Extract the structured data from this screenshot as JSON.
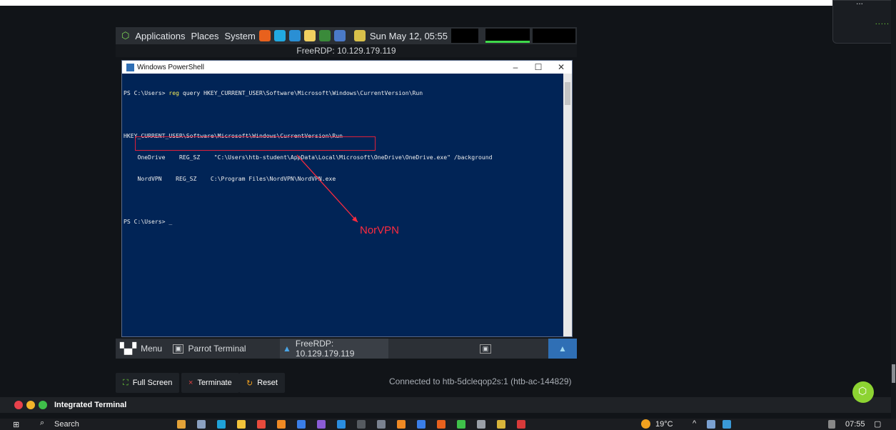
{
  "notification": {
    "line1": "...",
    "line2": "....."
  },
  "parrot_bar": {
    "applications": "Applications",
    "places": "Places",
    "system": "System",
    "datetime": "Sun May 12, 05:55"
  },
  "rdp_title": "FreeRDP: 10.129.179.119",
  "powershell": {
    "title": "Windows PowerShell",
    "minimize": "–",
    "maximize": "☐",
    "close": "✕",
    "lines": [
      {
        "prompt": "PS C:\\Users> ",
        "cmd": "reg",
        "rest": " query HKEY_CURRENT_USER\\Software\\Microsoft\\Windows\\CurrentVersion\\Run"
      },
      {
        "prompt": "",
        "cmd": "",
        "rest": ""
      },
      {
        "prompt": "",
        "cmd": "",
        "rest": "HKEY_CURRENT_USER\\Software\\Microsoft\\Windows\\CurrentVersion\\Run"
      },
      {
        "prompt": "",
        "cmd": "",
        "rest": "    OneDrive    REG_SZ    \"C:\\Users\\htb-student\\AppData\\Local\\Microsoft\\OneDrive\\OneDrive.exe\" /background"
      },
      {
        "prompt": "",
        "cmd": "",
        "rest": "    NordVPN    REG_SZ    C:\\Program Files\\NordVPN\\NordVPN.exe"
      },
      {
        "prompt": "",
        "cmd": "",
        "rest": ""
      },
      {
        "prompt": "PS C:\\Users> ",
        "cmd": "",
        "rest": "_"
      }
    ],
    "annotation": "NorVPN"
  },
  "parrot_taskbar": {
    "menu": "Menu",
    "terminal": "Parrot Terminal",
    "freerdp": "FreeRDP: 10.129.179.119"
  },
  "controls": {
    "fullscreen": "Full Screen",
    "terminate": "Terminate",
    "reset": "Reset",
    "connected": "Connected to htb-5dcleqop2s:1 (htb-ac-144829)"
  },
  "integrated_terminal": "Integrated Terminal",
  "windows_taskbar": {
    "search": "Search",
    "temperature": "19°C",
    "time": "07:55"
  },
  "colors": {
    "powershell_bg": "#012456",
    "annotation_red": "#ff2b3e",
    "accent_green": "#8dd332"
  }
}
